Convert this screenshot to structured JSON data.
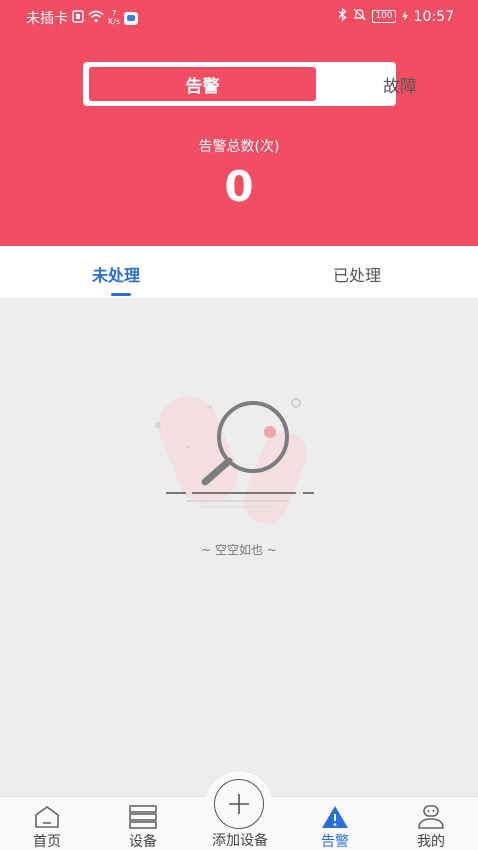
{
  "status_bar": {
    "carrier": "未插卡",
    "net_speed_value": "7",
    "net_speed_unit": "K/s",
    "battery": "100",
    "time": "10:57"
  },
  "segmented": {
    "active": "告警",
    "inactive": "故障"
  },
  "summary": {
    "label": "告警总数(次)",
    "value": "0"
  },
  "tabs": {
    "active": "未处理",
    "inactive": "已处理"
  },
  "empty": {
    "text": "~ 空空如也 ~"
  },
  "bottom_nav": {
    "home": "首页",
    "devices": "设备",
    "add_device": "添加设备",
    "alarms": "告警",
    "mine": "我的"
  },
  "colors": {
    "accent": "#f24d63",
    "blue": "#2b6fd6"
  }
}
